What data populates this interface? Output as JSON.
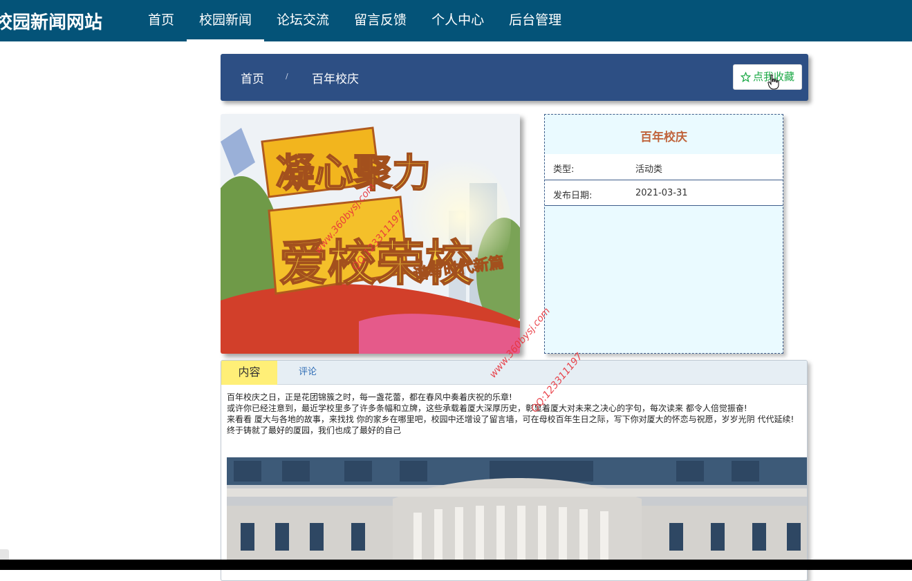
{
  "header": {
    "site_title": "校园新闻网站",
    "nav": [
      "首页",
      "校园新闻",
      "论坛交流",
      "留言反馈",
      "个人中心",
      "后台管理"
    ],
    "active_nav": "校园新闻"
  },
  "breadcrumb": {
    "home": "首页",
    "separator": "/",
    "current": "百年校庆",
    "favorite_button": "点我收藏"
  },
  "photo": {
    "sign_line1": "凝心聚力",
    "sign_line2": "爱校荣校",
    "sign_side": "谱写时代新篇"
  },
  "info": {
    "title": "百年校庆",
    "rows": [
      {
        "label": "类型:",
        "value": "活动类"
      },
      {
        "label": "发布日期:",
        "value": "2021-03-31"
      }
    ]
  },
  "tabs": {
    "content_label": "内容",
    "comment_label": "评论"
  },
  "article": {
    "paragraphs": [
      "百年校庆之日，正是花团锦簇之时，每一盏花蕾，都在春风中奏着庆祝的乐章!",
      "或许你已经注意到，最近学校里多了许多条幅和立牌，这些承载着厦大深厚历史，彰显着厦大对未来之决心的字句，每次读来 都令人倍觉振奋!",
      "来看看 厦大与各地的故事，来找找 你的家乡在哪里吧，校园中还增设了留言墙，可在母校百年生日之际，写下你对厦大的怀恋与祝愿，岁岁光阴 代代延续!",
      "终于铸就了最好的厦园，我们也成了最好的自己"
    ]
  },
  "watermarks": {
    "site": "www.360bysj.com",
    "qq": "QQ:123311197"
  },
  "colors": {
    "header_bg": "#045378",
    "crumb_bg": "#2d4f84",
    "info_title": "#c0643c",
    "tab_active": "#ffef77",
    "favorite_text": "#1aa845"
  }
}
